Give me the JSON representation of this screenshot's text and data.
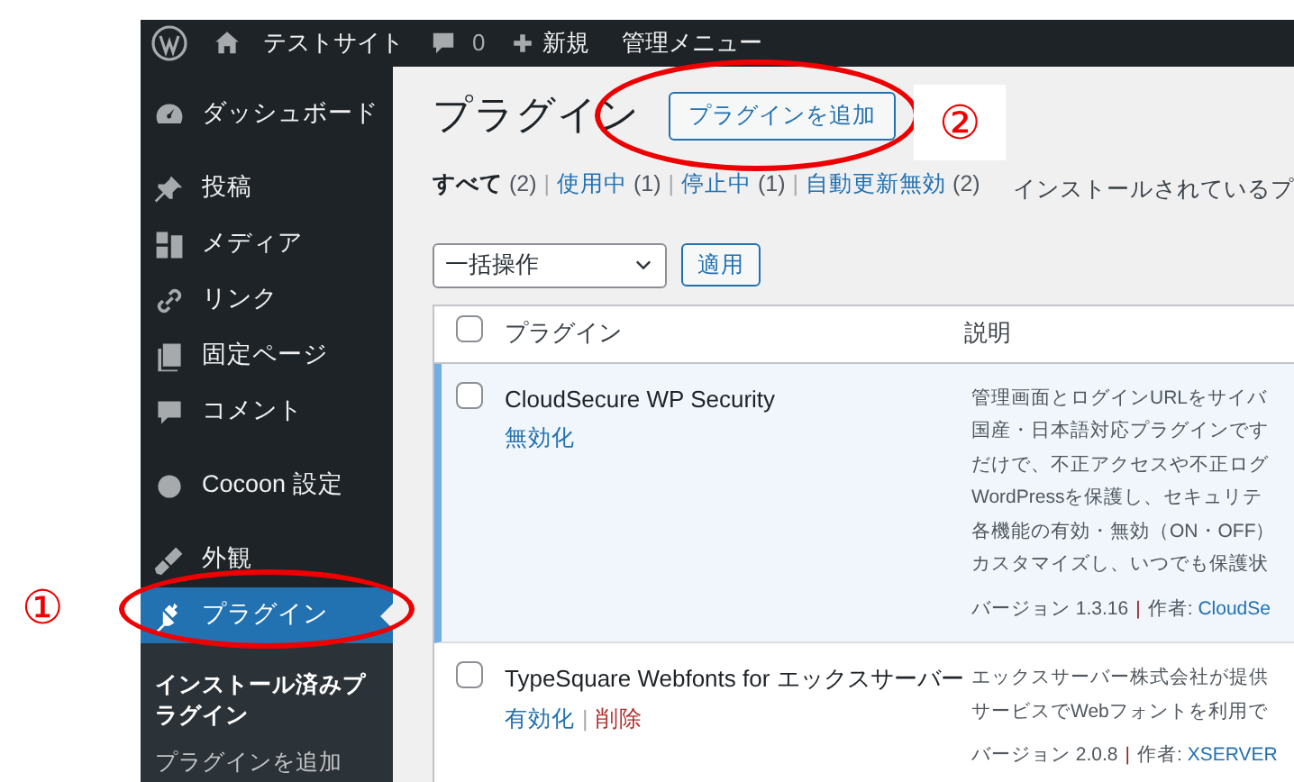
{
  "admin_bar": {
    "site": "テストサイト",
    "comments": "0",
    "new": "新規",
    "menu": "管理メニュー"
  },
  "sidebar": {
    "items": [
      {
        "label": "ダッシュボード",
        "selected": false
      },
      {
        "label": "投稿",
        "selected": false
      },
      {
        "label": "メディア",
        "selected": false
      },
      {
        "label": "リンク",
        "selected": false
      },
      {
        "label": "固定ページ",
        "selected": false
      },
      {
        "label": "コメント",
        "selected": false
      },
      {
        "label": "Cocoon 設定",
        "selected": false
      },
      {
        "label": "外観",
        "selected": false
      },
      {
        "label": "プラグイン",
        "selected": true,
        "children": [
          {
            "label": "インストール済みプラグイン",
            "selected": true
          },
          {
            "label": "プラグインを追加",
            "selected": false
          }
        ]
      }
    ]
  },
  "page": {
    "title": "プラグイン",
    "add_button": "プラグインを追加",
    "filters": [
      {
        "label": "すべて",
        "count": "(2)",
        "selected": true
      },
      {
        "label": "使用中",
        "count": "(1)",
        "selected": false
      },
      {
        "label": "停止中",
        "count": "(1)",
        "selected": false
      },
      {
        "label": "自動更新無効",
        "count": "(2)",
        "selected": false
      }
    ],
    "separator": "|",
    "note": "インストールされているプ",
    "bulk_select": "一括操作",
    "apply_button": "適用"
  },
  "table": {
    "columns": [
      "プラグイン",
      "説明"
    ],
    "header_checked": false,
    "separator": "|",
    "rows": [
      {
        "name": "CloudSecure WP Security",
        "active": true,
        "checked": false,
        "actions": [
          {
            "label": "無効化",
            "kind": "normal"
          }
        ],
        "description": [
          "管理画面とログインURLをサイバ",
          "国産・日本語対応プラグインです",
          "だけで、不正アクセスや不正ログ",
          "WordPressを保護し、セキュリテ",
          "各機能の有効・無効（ON・OFF）",
          "カスタマイズし、いつでも保護状"
        ],
        "version": "バージョン 1.3.16",
        "author_label": "作者:",
        "author": "CloudSe"
      },
      {
        "name": "TypeSquare Webfonts for エックスサーバー",
        "active": false,
        "checked": false,
        "actions": [
          {
            "label": "有効化",
            "kind": "normal"
          },
          {
            "label": "削除",
            "kind": "delete"
          }
        ],
        "description": [
          "エックスサーバー株式会社が提供",
          "サービスでWebフォントを利用で"
        ],
        "version": "バージョン 2.0.8",
        "author_label": "作者:",
        "author": "XSERVER"
      }
    ]
  },
  "annotations": [
    {
      "label": "①"
    },
    {
      "label": "②"
    }
  ]
}
